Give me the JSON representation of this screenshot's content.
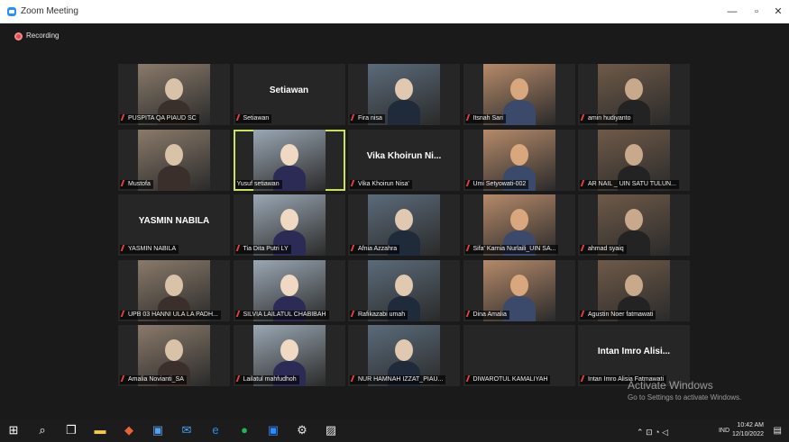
{
  "window": {
    "title": "Zoom Meeting"
  },
  "meeting": {
    "recording_label": "Recording"
  },
  "participants": [
    {
      "label": "PUSPITA QA PIAUD SC",
      "video": true
    },
    {
      "label": "Setiawan",
      "video": false,
      "display_name": "Setiawan"
    },
    {
      "label": "Fira nisa",
      "video": true
    },
    {
      "label": "Itsnah Sari",
      "video": true
    },
    {
      "label": "amin hudiyanto",
      "video": true
    },
    {
      "label": "Mustofa",
      "video": true
    },
    {
      "label": "Yusuf setiawan",
      "video": true,
      "active_speaker": true
    },
    {
      "label": "Vika Khoirun Nisa'",
      "video": false,
      "display_name": "Vika Khoirun Ni..."
    },
    {
      "label": "Umi Setyowati-002",
      "video": true
    },
    {
      "label": "AR NAIL _ UIN SATU TULUN...",
      "video": true
    },
    {
      "label": "YASMIN NABILA",
      "video": false,
      "display_name": "YASMIN NABILA"
    },
    {
      "label": "Tia Dita Putri LY",
      "video": true
    },
    {
      "label": "Afnia Azzahra",
      "video": true
    },
    {
      "label": "Sifa' Karnia Nurlaili_UIN SA...",
      "video": true
    },
    {
      "label": "ahmad syaiq",
      "video": true
    },
    {
      "label": "UPB 03 HANNI ULA LA PADH...",
      "video": true
    },
    {
      "label": "SILVIA LAILATUL CHABIBAH",
      "video": true
    },
    {
      "label": "Rafikazabi umah",
      "video": true
    },
    {
      "label": "Dina Amalia",
      "video": true
    },
    {
      "label": "Agustin Noer fatmawati",
      "video": true
    },
    {
      "label": "Amalia Novianti_SA",
      "video": true
    },
    {
      "label": "Lailatul mahfudhoh",
      "video": true
    },
    {
      "label": "NUR HAMNAH IZZAT_PIAU...",
      "video": true
    },
    {
      "label": "DIWAROTUL KAMALIYAH",
      "video": false
    },
    {
      "label": "Intan Imro Alisia Fatmawati",
      "video": false,
      "display_name": "Intan Imro Alisi..."
    }
  ],
  "watermark": {
    "title": "Activate Windows",
    "subtitle": "Go to Settings to activate Windows."
  },
  "taskbar": {
    "icons": [
      "windows-start-icon",
      "search-icon",
      "task-view-icon",
      "file-explorer-icon",
      "office-icon",
      "store-icon",
      "mail-icon",
      "edge-icon",
      "spotify-icon",
      "zoom-icon",
      "settings-icon",
      "photos-icon"
    ],
    "tray": {
      "language": "IND",
      "time": "10:42 AM",
      "date": "12/10/2022"
    }
  },
  "colors": {
    "active_speaker_border": "#c8e35a",
    "recording": "#e24b4b",
    "muted_mic": "#e04040",
    "meeting_bg": "#1a1a1a"
  }
}
